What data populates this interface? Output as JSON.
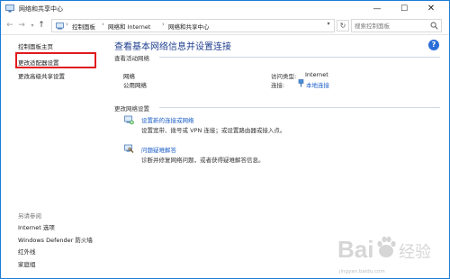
{
  "window": {
    "title": "网络和共享中心",
    "minimize_glyph": "—",
    "maximize_glyph": "☐",
    "close_glyph": "✕"
  },
  "navigation": {
    "back_glyph": "←",
    "forward_glyph": "→",
    "history_glyph": "▾",
    "up_glyph": "↑"
  },
  "address": {
    "crumbs": [
      "控制面板",
      "网络和 Internet",
      "网络和共享中心"
    ],
    "separator": "›",
    "dropdown_glyph": "▾",
    "refresh_glyph": "↻"
  },
  "search": {
    "placeholder": "搜索控制面板"
  },
  "help": {
    "label": "?"
  },
  "leftnav": {
    "home": "控制面板主页",
    "adapter": "更改适配器设置",
    "advanced": "更改高级共享设置",
    "see_also_title": "另请参阅",
    "see_also": [
      "Internet 选项",
      "Windows Defender 防火墙",
      "红外线",
      "家庭组"
    ]
  },
  "main": {
    "title": "查看基本网络信息并设置连接",
    "active_networks_label": "查看活动网络",
    "network_name": "网络",
    "network_type": "公用网络",
    "access_type_label": "访问类型:",
    "access_type_value": "Internet",
    "connections_label": "连接:",
    "connections_value": "本地连接",
    "change_settings_label": "更改网络设置",
    "tasks": [
      {
        "link": "设置新的连接或网络",
        "desc": "设置宽带、拨号或 VPN 连接；或设置路由器或接入点。"
      },
      {
        "link": "问题疑难解答",
        "desc": "诊断并修复网络问题，或者获得疑难解答信息。"
      }
    ]
  },
  "watermark": {
    "text": "jingyan.baidu.com"
  },
  "colors": {
    "accent_title": "#1f3f8f",
    "link": "#1b5ec8",
    "highlight": "#e0191e",
    "window_border": "#1c7ed6"
  }
}
